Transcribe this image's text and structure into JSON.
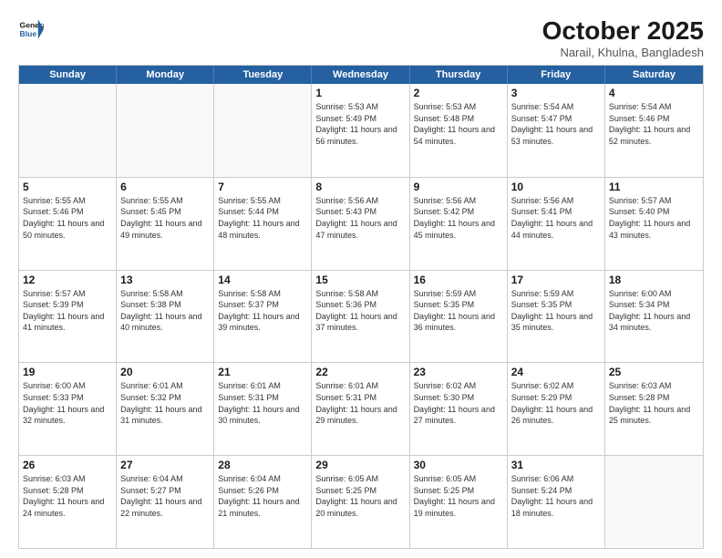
{
  "header": {
    "logo_line1": "General",
    "logo_line2": "Blue",
    "month_title": "October 2025",
    "location": "Narail, Khulna, Bangladesh"
  },
  "weekdays": [
    "Sunday",
    "Monday",
    "Tuesday",
    "Wednesday",
    "Thursday",
    "Friday",
    "Saturday"
  ],
  "weeks": [
    [
      {
        "day": "",
        "info": ""
      },
      {
        "day": "",
        "info": ""
      },
      {
        "day": "",
        "info": ""
      },
      {
        "day": "1",
        "info": "Sunrise: 5:53 AM\nSunset: 5:49 PM\nDaylight: 11 hours\nand 56 minutes."
      },
      {
        "day": "2",
        "info": "Sunrise: 5:53 AM\nSunset: 5:48 PM\nDaylight: 11 hours\nand 54 minutes."
      },
      {
        "day": "3",
        "info": "Sunrise: 5:54 AM\nSunset: 5:47 PM\nDaylight: 11 hours\nand 53 minutes."
      },
      {
        "day": "4",
        "info": "Sunrise: 5:54 AM\nSunset: 5:46 PM\nDaylight: 11 hours\nand 52 minutes."
      }
    ],
    [
      {
        "day": "5",
        "info": "Sunrise: 5:55 AM\nSunset: 5:46 PM\nDaylight: 11 hours\nand 50 minutes."
      },
      {
        "day": "6",
        "info": "Sunrise: 5:55 AM\nSunset: 5:45 PM\nDaylight: 11 hours\nand 49 minutes."
      },
      {
        "day": "7",
        "info": "Sunrise: 5:55 AM\nSunset: 5:44 PM\nDaylight: 11 hours\nand 48 minutes."
      },
      {
        "day": "8",
        "info": "Sunrise: 5:56 AM\nSunset: 5:43 PM\nDaylight: 11 hours\nand 47 minutes."
      },
      {
        "day": "9",
        "info": "Sunrise: 5:56 AM\nSunset: 5:42 PM\nDaylight: 11 hours\nand 45 minutes."
      },
      {
        "day": "10",
        "info": "Sunrise: 5:56 AM\nSunset: 5:41 PM\nDaylight: 11 hours\nand 44 minutes."
      },
      {
        "day": "11",
        "info": "Sunrise: 5:57 AM\nSunset: 5:40 PM\nDaylight: 11 hours\nand 43 minutes."
      }
    ],
    [
      {
        "day": "12",
        "info": "Sunrise: 5:57 AM\nSunset: 5:39 PM\nDaylight: 11 hours\nand 41 minutes."
      },
      {
        "day": "13",
        "info": "Sunrise: 5:58 AM\nSunset: 5:38 PM\nDaylight: 11 hours\nand 40 minutes."
      },
      {
        "day": "14",
        "info": "Sunrise: 5:58 AM\nSunset: 5:37 PM\nDaylight: 11 hours\nand 39 minutes."
      },
      {
        "day": "15",
        "info": "Sunrise: 5:58 AM\nSunset: 5:36 PM\nDaylight: 11 hours\nand 37 minutes."
      },
      {
        "day": "16",
        "info": "Sunrise: 5:59 AM\nSunset: 5:35 PM\nDaylight: 11 hours\nand 36 minutes."
      },
      {
        "day": "17",
        "info": "Sunrise: 5:59 AM\nSunset: 5:35 PM\nDaylight: 11 hours\nand 35 minutes."
      },
      {
        "day": "18",
        "info": "Sunrise: 6:00 AM\nSunset: 5:34 PM\nDaylight: 11 hours\nand 34 minutes."
      }
    ],
    [
      {
        "day": "19",
        "info": "Sunrise: 6:00 AM\nSunset: 5:33 PM\nDaylight: 11 hours\nand 32 minutes."
      },
      {
        "day": "20",
        "info": "Sunrise: 6:01 AM\nSunset: 5:32 PM\nDaylight: 11 hours\nand 31 minutes."
      },
      {
        "day": "21",
        "info": "Sunrise: 6:01 AM\nSunset: 5:31 PM\nDaylight: 11 hours\nand 30 minutes."
      },
      {
        "day": "22",
        "info": "Sunrise: 6:01 AM\nSunset: 5:31 PM\nDaylight: 11 hours\nand 29 minutes."
      },
      {
        "day": "23",
        "info": "Sunrise: 6:02 AM\nSunset: 5:30 PM\nDaylight: 11 hours\nand 27 minutes."
      },
      {
        "day": "24",
        "info": "Sunrise: 6:02 AM\nSunset: 5:29 PM\nDaylight: 11 hours\nand 26 minutes."
      },
      {
        "day": "25",
        "info": "Sunrise: 6:03 AM\nSunset: 5:28 PM\nDaylight: 11 hours\nand 25 minutes."
      }
    ],
    [
      {
        "day": "26",
        "info": "Sunrise: 6:03 AM\nSunset: 5:28 PM\nDaylight: 11 hours\nand 24 minutes."
      },
      {
        "day": "27",
        "info": "Sunrise: 6:04 AM\nSunset: 5:27 PM\nDaylight: 11 hours\nand 22 minutes."
      },
      {
        "day": "28",
        "info": "Sunrise: 6:04 AM\nSunset: 5:26 PM\nDaylight: 11 hours\nand 21 minutes."
      },
      {
        "day": "29",
        "info": "Sunrise: 6:05 AM\nSunset: 5:25 PM\nDaylight: 11 hours\nand 20 minutes."
      },
      {
        "day": "30",
        "info": "Sunrise: 6:05 AM\nSunset: 5:25 PM\nDaylight: 11 hours\nand 19 minutes."
      },
      {
        "day": "31",
        "info": "Sunrise: 6:06 AM\nSunset: 5:24 PM\nDaylight: 11 hours\nand 18 minutes."
      },
      {
        "day": "",
        "info": ""
      }
    ]
  ]
}
